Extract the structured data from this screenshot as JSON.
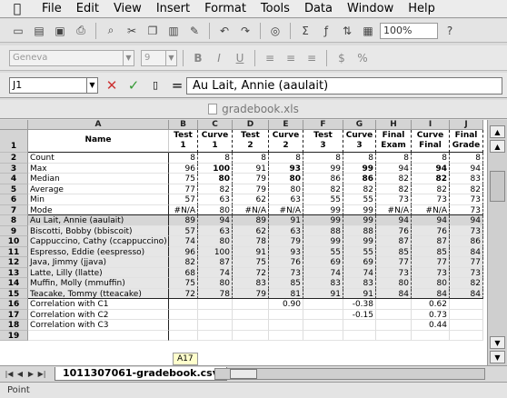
{
  "menubar": {
    "items": [
      "File",
      "Edit",
      "View",
      "Insert",
      "Format",
      "Tools",
      "Data",
      "Window",
      "Help"
    ]
  },
  "toolbar": {
    "zoom": "100%",
    "icons": [
      "new-icon",
      "open-icon",
      "save-icon",
      "print-icon",
      "preview-icon",
      "cut-icon",
      "copy-icon",
      "paste-icon",
      "format-painter-icon",
      "undo-icon",
      "redo-icon",
      "web-icon",
      "sum-icon",
      "function-icon",
      "sort-icon",
      "chart-icon",
      "help-icon"
    ]
  },
  "format_toolbar": {
    "font": "Geneva",
    "size": "9",
    "buttons": [
      "B",
      "I",
      "U",
      "≡",
      "≡",
      "≡",
      "$",
      "%"
    ]
  },
  "formula": {
    "cell": "J1",
    "value": "Au Lait, Annie (aaulait)"
  },
  "window": {
    "title": "gradebook.xls"
  },
  "columns": [
    "A",
    "B",
    "C",
    "D",
    "E",
    "F",
    "G",
    "H",
    "I",
    "J"
  ],
  "header_row": [
    [
      "Name",
      ""
    ],
    [
      "Test",
      "1"
    ],
    [
      "Curve",
      "1"
    ],
    [
      "Test",
      "2"
    ],
    [
      "Curve",
      "2"
    ],
    [
      "Test",
      "3"
    ],
    [
      "Curve",
      "3"
    ],
    [
      "Final",
      "Exam"
    ],
    [
      "Curve",
      "Final"
    ],
    [
      "Final",
      "Grade"
    ]
  ],
  "rows": [
    {
      "n": "2",
      "cells": [
        "Count",
        "8",
        "8",
        "8",
        "8",
        "8",
        "8",
        "8",
        "8",
        "8"
      ]
    },
    {
      "n": "3",
      "cells": [
        "Max",
        "96",
        "100",
        "91",
        "93",
        "99",
        "99",
        "94",
        "94",
        "94"
      ]
    },
    {
      "n": "4",
      "cells": [
        "Median",
        "75",
        "80",
        "79",
        "80",
        "86",
        "86",
        "82",
        "82",
        "83"
      ]
    },
    {
      "n": "5",
      "cells": [
        "Average",
        "77",
        "82",
        "79",
        "80",
        "82",
        "82",
        "82",
        "82",
        "82"
      ]
    },
    {
      "n": "6",
      "cells": [
        "Min",
        "57",
        "63",
        "62",
        "63",
        "55",
        "55",
        "73",
        "73",
        "73"
      ]
    },
    {
      "n": "7",
      "cells": [
        "Mode",
        "#N/A",
        "80",
        "#N/A",
        "#N/A",
        "99",
        "99",
        "#N/A",
        "#N/A",
        "73"
      ]
    },
    {
      "n": "8",
      "cells": [
        "Au Lait, Annie (aaulait)",
        "89",
        "94",
        "89",
        "91",
        "99",
        "99",
        "94",
        "94",
        "94"
      ]
    },
    {
      "n": "9",
      "cells": [
        "Biscotti, Bobby (bbiscoit)",
        "57",
        "63",
        "62",
        "63",
        "88",
        "88",
        "76",
        "76",
        "73"
      ]
    },
    {
      "n": "10",
      "cells": [
        "Cappuccino, Cathy (ccappuccino)",
        "74",
        "80",
        "78",
        "79",
        "99",
        "99",
        "87",
        "87",
        "86"
      ]
    },
    {
      "n": "11",
      "cells": [
        "Espresso, Eddie (eespresso)",
        "96",
        "100",
        "91",
        "93",
        "55",
        "55",
        "85",
        "85",
        "84"
      ]
    },
    {
      "n": "12",
      "cells": [
        "Java, Jimmy (jjava)",
        "82",
        "87",
        "75",
        "76",
        "69",
        "69",
        "77",
        "77",
        "77"
      ]
    },
    {
      "n": "13",
      "cells": [
        "Latte, Lilly (llatte)",
        "68",
        "74",
        "72",
        "73",
        "74",
        "74",
        "73",
        "73",
        "73"
      ]
    },
    {
      "n": "14",
      "cells": [
        "Muffin, Molly (mmuffin)",
        "75",
        "80",
        "83",
        "85",
        "83",
        "83",
        "80",
        "80",
        "82"
      ]
    },
    {
      "n": "15",
      "cells": [
        "Teacake, Tommy (tteacake)",
        "72",
        "78",
        "79",
        "81",
        "91",
        "91",
        "84",
        "84",
        "84"
      ]
    },
    {
      "n": "16",
      "cells": [
        "Correlation with C1",
        "",
        "",
        "",
        "0.90",
        "",
        "-0.38",
        "",
        "0.62",
        ""
      ]
    },
    {
      "n": "17",
      "cells": [
        "Correlation with C2",
        "",
        "",
        "",
        "",
        "",
        "-0.15",
        "",
        "0.73",
        ""
      ]
    },
    {
      "n": "18",
      "cells": [
        "Correlation with C3",
        "",
        "",
        "",
        "",
        "",
        "",
        "",
        "0.44",
        ""
      ]
    },
    {
      "n": "19",
      "cells": [
        "",
        "",
        "",
        "",
        "",
        "",
        "",
        "",
        "",
        ""
      ]
    }
  ],
  "tooltip": "A17",
  "sheet_tab": "1011307061-gradebook.csv",
  "status": "Point"
}
